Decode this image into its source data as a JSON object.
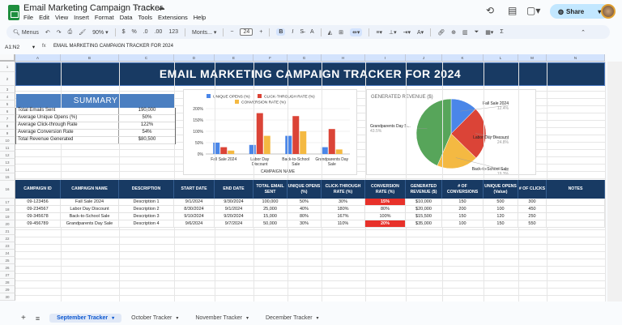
{
  "app": {
    "title": "Email Marketing Campaign Tracker",
    "menu": [
      "File",
      "Edit",
      "View",
      "Insert",
      "Format",
      "Data",
      "Tools",
      "Extensions",
      "Help"
    ],
    "share_label": "Share"
  },
  "toolbar": {
    "menus": "Menus",
    "zoom": "90%",
    "currency": "$",
    "percent": "%",
    "dec_less": ".0",
    "dec_more": ".00",
    "format_123": "123",
    "font": "Monts...",
    "font_size": "24",
    "bold": "B",
    "italic": "I"
  },
  "formula_bar": {
    "name_box": "A1:N2",
    "fx": "fx",
    "content": "EMAIL MARKETING CAMPAIGN TRACKER FOR 2024"
  },
  "columns": [
    "A",
    "B",
    "C",
    "D",
    "E",
    "F",
    "G",
    "H",
    "I",
    "J",
    "K",
    "L",
    "M",
    "N"
  ],
  "rows": [
    "1",
    "2",
    "3",
    "4",
    "5",
    "6",
    "7",
    "8",
    "9",
    "10",
    "11",
    "12",
    "13",
    "14",
    "15",
    "16",
    "17",
    "18",
    "19",
    "20",
    "21",
    "22",
    "23",
    "24",
    "25",
    "26",
    "27",
    "28",
    "29",
    "30",
    "31",
    "32"
  ],
  "banner": "EMAIL MARKETING CAMPAIGN TRACKER FOR 2024",
  "summary": {
    "title": "SUMMARY",
    "rows": [
      {
        "label": "Total Emails Sent",
        "value": "190,000"
      },
      {
        "label": "Average Unique Opens (%)",
        "value": "50%"
      },
      {
        "label": "Average Click-through Rate",
        "value": "122%"
      },
      {
        "label": "Average Conversion Rate",
        "value": "54%"
      },
      {
        "label": "Total Revenue Generated",
        "value": "$80,500"
      }
    ]
  },
  "chart_data": [
    {
      "type": "bar",
      "title": "",
      "xlabel": "CAMPAIGN NAME",
      "ylabel": "",
      "ylim": [
        0,
        200
      ],
      "yticks": [
        "0%",
        "50%",
        "100%",
        "150%",
        "200%"
      ],
      "grid": true,
      "legend": "top",
      "categories": [
        "Fall Sale 2024",
        "Labor Day Discount",
        "Back-to-School Sale",
        "Grandparents Day Sale"
      ],
      "series": [
        {
          "name": "UNIQUE OPENS (%)",
          "color": "#4a86e8",
          "values": [
            50,
            40,
            80,
            30
          ]
        },
        {
          "name": "CLICK-THROUGH RATE (%)",
          "color": "#db4437",
          "values": [
            30,
            180,
            167,
            110
          ]
        },
        {
          "name": "CONVERSION RATE (%)",
          "color": "#f4b942",
          "values": [
            15,
            80,
            100,
            20
          ]
        }
      ]
    },
    {
      "type": "pie",
      "title": "GENERATED REVENUE ($)",
      "legend": "labels",
      "slices": [
        {
          "label": "Fall Sale 2024",
          "value": 10000,
          "pct": "12.4%",
          "color": "#4a86e8"
        },
        {
          "label": "Labor Day Discount",
          "value": 20000,
          "pct": "24.8%",
          "color": "#db4437"
        },
        {
          "label": "Back-to-School Sale",
          "value": 15500,
          "pct": "19.3%",
          "color": "#f4b942"
        },
        {
          "label": "Grandparents Day S...",
          "value": 35000,
          "pct": "43.5%",
          "color": "#57a55a"
        }
      ]
    }
  ],
  "table": {
    "headers": [
      "CAMPAIGN ID",
      "CAMPAIGN NAME",
      "DESCRIPTION",
      "START DATE",
      "END DATE",
      "TOTAL EMAIL SENT",
      "UNIQUE OPENS (%)",
      "CLICK-THROUGH RATE (%)",
      "CONVERSION RATE (%)",
      "GENERATED REVENUE ($)",
      "# OF CONVERSIONS",
      "UNIQUE OPENS (Value)",
      "# OF CLICKS",
      "NOTES"
    ],
    "rows": [
      [
        "09-123456",
        "Fall Sale 2024",
        "Description 1",
        "9/1/2024",
        "9/30/2024",
        "100,000",
        "50%",
        "30%",
        "15%",
        "$10,000",
        "150",
        "500",
        "300",
        ""
      ],
      [
        "09-234567",
        "Labor Day Discount",
        "Description 2",
        "8/30/2024",
        "9/1/2024",
        "25,000",
        "40%",
        "180%",
        "80%",
        "$20,000",
        "200",
        "100",
        "450",
        ""
      ],
      [
        "09-345678",
        "Back-to-School Sale",
        "Description 3",
        "9/10/2024",
        "9/20/2024",
        "15,000",
        "80%",
        "167%",
        "100%",
        "$15,500",
        "150",
        "120",
        "250",
        ""
      ],
      [
        "09-456789",
        "Grandparents Day Sale",
        "Description 4",
        "9/6/2024",
        "9/7/2024",
        "50,000",
        "30%",
        "110%",
        "20%",
        "$35,000",
        "100",
        "150",
        "550",
        ""
      ]
    ],
    "highlight_color": "#e8312a"
  },
  "sheets": {
    "active": "September Tracker",
    "tabs": [
      "September Tracker",
      "October Tracker",
      "November Tracker",
      "December Tracker"
    ]
  }
}
